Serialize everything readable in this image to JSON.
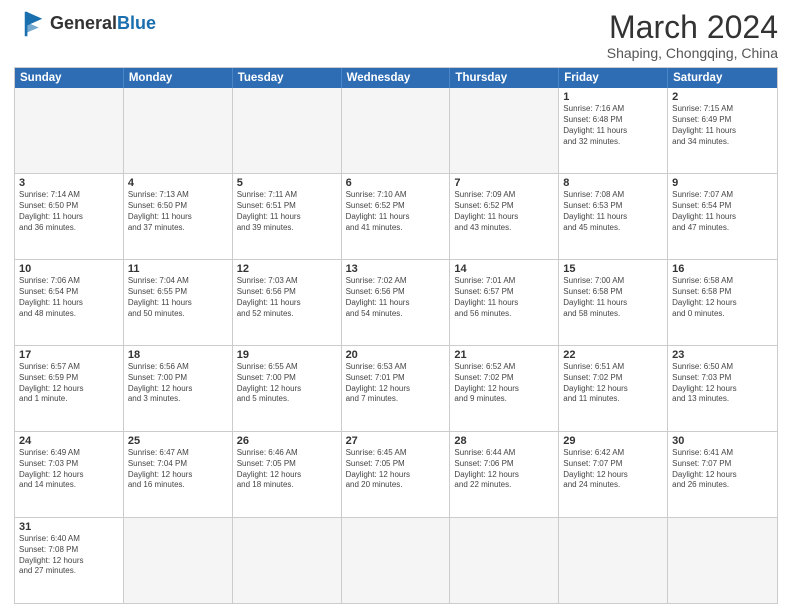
{
  "header": {
    "logo_general": "General",
    "logo_blue": "Blue",
    "title": "March 2024",
    "subtitle": "Shaping, Chongqing, China"
  },
  "days_of_week": [
    "Sunday",
    "Monday",
    "Tuesday",
    "Wednesday",
    "Thursday",
    "Friday",
    "Saturday"
  ],
  "weeks": [
    [
      {
        "num": "",
        "info": "",
        "empty": true
      },
      {
        "num": "",
        "info": "",
        "empty": true
      },
      {
        "num": "",
        "info": "",
        "empty": true
      },
      {
        "num": "",
        "info": "",
        "empty": true
      },
      {
        "num": "",
        "info": "",
        "empty": true
      },
      {
        "num": "1",
        "info": "Sunrise: 7:16 AM\nSunset: 6:48 PM\nDaylight: 11 hours\nand 32 minutes.",
        "empty": false
      },
      {
        "num": "2",
        "info": "Sunrise: 7:15 AM\nSunset: 6:49 PM\nDaylight: 11 hours\nand 34 minutes.",
        "empty": false
      }
    ],
    [
      {
        "num": "3",
        "info": "Sunrise: 7:14 AM\nSunset: 6:50 PM\nDaylight: 11 hours\nand 36 minutes.",
        "empty": false
      },
      {
        "num": "4",
        "info": "Sunrise: 7:13 AM\nSunset: 6:50 PM\nDaylight: 11 hours\nand 37 minutes.",
        "empty": false
      },
      {
        "num": "5",
        "info": "Sunrise: 7:11 AM\nSunset: 6:51 PM\nDaylight: 11 hours\nand 39 minutes.",
        "empty": false
      },
      {
        "num": "6",
        "info": "Sunrise: 7:10 AM\nSunset: 6:52 PM\nDaylight: 11 hours\nand 41 minutes.",
        "empty": false
      },
      {
        "num": "7",
        "info": "Sunrise: 7:09 AM\nSunset: 6:52 PM\nDaylight: 11 hours\nand 43 minutes.",
        "empty": false
      },
      {
        "num": "8",
        "info": "Sunrise: 7:08 AM\nSunset: 6:53 PM\nDaylight: 11 hours\nand 45 minutes.",
        "empty": false
      },
      {
        "num": "9",
        "info": "Sunrise: 7:07 AM\nSunset: 6:54 PM\nDaylight: 11 hours\nand 47 minutes.",
        "empty": false
      }
    ],
    [
      {
        "num": "10",
        "info": "Sunrise: 7:06 AM\nSunset: 6:54 PM\nDaylight: 11 hours\nand 48 minutes.",
        "empty": false
      },
      {
        "num": "11",
        "info": "Sunrise: 7:04 AM\nSunset: 6:55 PM\nDaylight: 11 hours\nand 50 minutes.",
        "empty": false
      },
      {
        "num": "12",
        "info": "Sunrise: 7:03 AM\nSunset: 6:56 PM\nDaylight: 11 hours\nand 52 minutes.",
        "empty": false
      },
      {
        "num": "13",
        "info": "Sunrise: 7:02 AM\nSunset: 6:56 PM\nDaylight: 11 hours\nand 54 minutes.",
        "empty": false
      },
      {
        "num": "14",
        "info": "Sunrise: 7:01 AM\nSunset: 6:57 PM\nDaylight: 11 hours\nand 56 minutes.",
        "empty": false
      },
      {
        "num": "15",
        "info": "Sunrise: 7:00 AM\nSunset: 6:58 PM\nDaylight: 11 hours\nand 58 minutes.",
        "empty": false
      },
      {
        "num": "16",
        "info": "Sunrise: 6:58 AM\nSunset: 6:58 PM\nDaylight: 12 hours\nand 0 minutes.",
        "empty": false
      }
    ],
    [
      {
        "num": "17",
        "info": "Sunrise: 6:57 AM\nSunset: 6:59 PM\nDaylight: 12 hours\nand 1 minute.",
        "empty": false
      },
      {
        "num": "18",
        "info": "Sunrise: 6:56 AM\nSunset: 7:00 PM\nDaylight: 12 hours\nand 3 minutes.",
        "empty": false
      },
      {
        "num": "19",
        "info": "Sunrise: 6:55 AM\nSunset: 7:00 PM\nDaylight: 12 hours\nand 5 minutes.",
        "empty": false
      },
      {
        "num": "20",
        "info": "Sunrise: 6:53 AM\nSunset: 7:01 PM\nDaylight: 12 hours\nand 7 minutes.",
        "empty": false
      },
      {
        "num": "21",
        "info": "Sunrise: 6:52 AM\nSunset: 7:02 PM\nDaylight: 12 hours\nand 9 minutes.",
        "empty": false
      },
      {
        "num": "22",
        "info": "Sunrise: 6:51 AM\nSunset: 7:02 PM\nDaylight: 12 hours\nand 11 minutes.",
        "empty": false
      },
      {
        "num": "23",
        "info": "Sunrise: 6:50 AM\nSunset: 7:03 PM\nDaylight: 12 hours\nand 13 minutes.",
        "empty": false
      }
    ],
    [
      {
        "num": "24",
        "info": "Sunrise: 6:49 AM\nSunset: 7:03 PM\nDaylight: 12 hours\nand 14 minutes.",
        "empty": false
      },
      {
        "num": "25",
        "info": "Sunrise: 6:47 AM\nSunset: 7:04 PM\nDaylight: 12 hours\nand 16 minutes.",
        "empty": false
      },
      {
        "num": "26",
        "info": "Sunrise: 6:46 AM\nSunset: 7:05 PM\nDaylight: 12 hours\nand 18 minutes.",
        "empty": false
      },
      {
        "num": "27",
        "info": "Sunrise: 6:45 AM\nSunset: 7:05 PM\nDaylight: 12 hours\nand 20 minutes.",
        "empty": false
      },
      {
        "num": "28",
        "info": "Sunrise: 6:44 AM\nSunset: 7:06 PM\nDaylight: 12 hours\nand 22 minutes.",
        "empty": false
      },
      {
        "num": "29",
        "info": "Sunrise: 6:42 AM\nSunset: 7:07 PM\nDaylight: 12 hours\nand 24 minutes.",
        "empty": false
      },
      {
        "num": "30",
        "info": "Sunrise: 6:41 AM\nSunset: 7:07 PM\nDaylight: 12 hours\nand 26 minutes.",
        "empty": false
      }
    ],
    [
      {
        "num": "31",
        "info": "Sunrise: 6:40 AM\nSunset: 7:08 PM\nDaylight: 12 hours\nand 27 minutes.",
        "empty": false
      },
      {
        "num": "",
        "info": "",
        "empty": true
      },
      {
        "num": "",
        "info": "",
        "empty": true
      },
      {
        "num": "",
        "info": "",
        "empty": true
      },
      {
        "num": "",
        "info": "",
        "empty": true
      },
      {
        "num": "",
        "info": "",
        "empty": true
      },
      {
        "num": "",
        "info": "",
        "empty": true
      }
    ]
  ]
}
